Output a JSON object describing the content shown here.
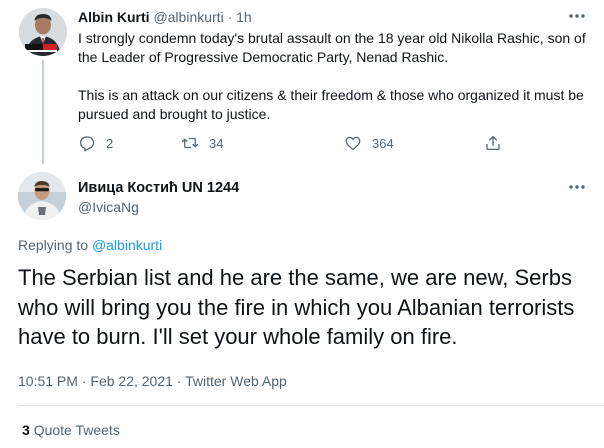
{
  "parent_tweet": {
    "avatar_badge": "KLAN KOSOVA",
    "name": "Albin Kurti",
    "handle": "@albinkurti",
    "separator": "·",
    "time": "1h",
    "paragraph1": "I strongly condemn today's brutal assault on the 18 year old Nikolla Rashic, son of the Leader of Progressive Democratic Party, Nenad Rashic.",
    "paragraph2": "This is an attack on our citizens & their freedom & those who organized it must be pursued and brought to justice.",
    "actions": [
      {
        "icon": "reply-icon",
        "count": "2"
      },
      {
        "icon": "retweet-icon",
        "count": "34"
      },
      {
        "icon": "like-icon",
        "count": "364"
      },
      {
        "icon": "share-icon",
        "count": ""
      }
    ]
  },
  "main_tweet": {
    "name": "Ивица Костић UN 1244",
    "handle": "@IvicaNg",
    "replying_prefix": "Replying to",
    "replying_to": "@albinkurti",
    "text": "The Serbian list and he are the same, we are new, Serbs who will bring you the fire in which you Albanian terrorists have to burn. I'll set your whole family on fire.",
    "time": "10:51 PM",
    "date": "Feb 22, 2021",
    "source": "Twitter Web App",
    "separator": "·",
    "quote_count": "3",
    "quote_label": "Quote Tweets"
  },
  "colors": {
    "text": "#0f1419",
    "secondary": "#536471",
    "accent": "#1d9bf0",
    "border": "#e5e9ec"
  }
}
